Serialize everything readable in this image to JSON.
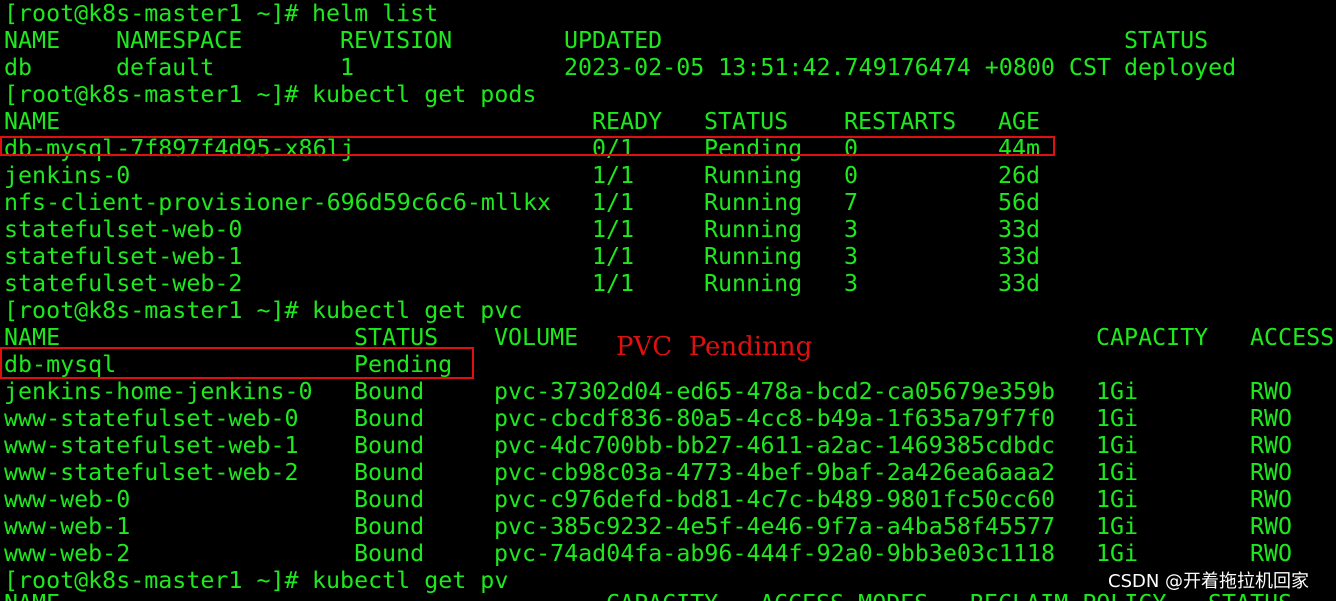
{
  "prompt": "[root@k8s-master1 ~]#",
  "helm": {
    "command": "helm list",
    "header": [
      "NAME",
      "NAMESPACE",
      "REVISION",
      "UPDATED",
      "STATUS"
    ],
    "rows": [
      [
        "db",
        "default",
        "1",
        "2023-02-05 13:51:42.749176474 +0800 CST",
        "deployed"
      ]
    ]
  },
  "pods": {
    "command": "kubectl get pods",
    "header": [
      "NAME",
      "READY",
      "STATUS",
      "RESTARTS",
      "AGE"
    ],
    "rows": [
      [
        "db-mysql-7f897f4d95-x86lj",
        "0/1",
        "Pending",
        "0",
        "44m"
      ],
      [
        "jenkins-0",
        "1/1",
        "Running",
        "0",
        "26d"
      ],
      [
        "nfs-client-provisioner-696d59c6c6-mllkx",
        "1/1",
        "Running",
        "7",
        "56d"
      ],
      [
        "statefulset-web-0",
        "1/1",
        "Running",
        "3",
        "33d"
      ],
      [
        "statefulset-web-1",
        "1/1",
        "Running",
        "3",
        "33d"
      ],
      [
        "statefulset-web-2",
        "1/1",
        "Running",
        "3",
        "33d"
      ]
    ]
  },
  "pvc": {
    "command": "kubectl get pvc",
    "header": [
      "NAME",
      "STATUS",
      "VOLUME",
      "CAPACITY",
      "ACCESS"
    ],
    "rows": [
      [
        "db-mysql",
        "Pending",
        "",
        "",
        ""
      ],
      [
        "jenkins-home-jenkins-0",
        "Bound",
        "pvc-37302d04-ed65-478a-bcd2-ca05679e359b",
        "1Gi",
        "RWO"
      ],
      [
        "www-statefulset-web-0",
        "Bound",
        "pvc-cbcdf836-80a5-4cc8-b49a-1f635a79f7f0",
        "1Gi",
        "RWO"
      ],
      [
        "www-statefulset-web-1",
        "Bound",
        "pvc-4dc700bb-bb27-4611-a2ac-1469385cdbdc",
        "1Gi",
        "RWO"
      ],
      [
        "www-statefulset-web-2",
        "Bound",
        "pvc-cb98c03a-4773-4bef-9baf-2a426ea6aaa2",
        "1Gi",
        "RWO"
      ],
      [
        "www-web-0",
        "Bound",
        "pvc-c976defd-bd81-4c7c-b489-9801fc50cc60",
        "1Gi",
        "RWO"
      ],
      [
        "www-web-1",
        "Bound",
        "pvc-385c9232-4e5f-4e46-9f7a-a4ba58f45577",
        "1Gi",
        "RWO"
      ],
      [
        "www-web-2",
        "Bound",
        "pvc-74ad04fa-ab96-444f-92a0-9bb3e03c1118",
        "1Gi",
        "RWO"
      ]
    ]
  },
  "pv": {
    "command": "kubectl get pv",
    "header_partial": [
      "NAME",
      "CAPACITY",
      "ACCESS MODES",
      "RECLAIM POLICY",
      "STATUS"
    ]
  },
  "annotation": "PVC  Pendinng",
  "watermark": "CSDN @开着拖拉机回家",
  "colors": {
    "background": "#000000",
    "text": "#1ee81e",
    "highlight": "#e01010",
    "watermark": "#ffffff"
  }
}
